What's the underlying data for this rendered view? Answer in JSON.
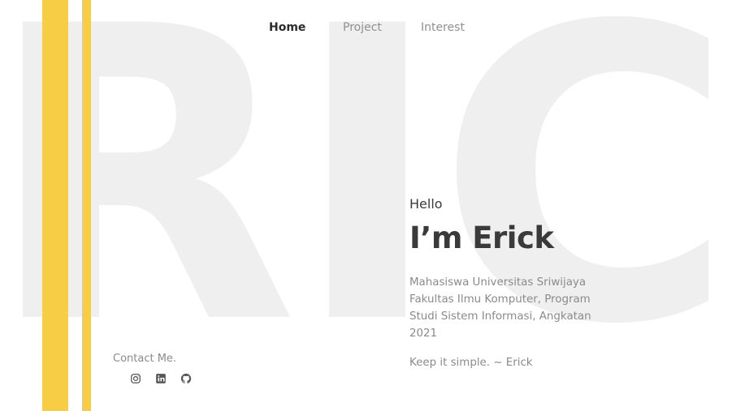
{
  "background": {
    "word": "RICK"
  },
  "nav": {
    "items": [
      {
        "label": "Home",
        "active": true
      },
      {
        "label": "Project",
        "active": false
      },
      {
        "label": "Interest",
        "active": false
      }
    ]
  },
  "hero": {
    "greeting": "Hello",
    "name": "I’m Erick",
    "bio": "Mahasiswa Universitas Sriwijaya Fakultas Ilmu Komputer, Program Studi Sistem Informasi, Angkatan 2021",
    "tagline": "Keep it simple. ~ Erick"
  },
  "contact": {
    "label": "Contact Me.",
    "socials": [
      {
        "icon": "instagram-icon"
      },
      {
        "icon": "linkedin-icon"
      },
      {
        "icon": "github-icon"
      }
    ]
  },
  "colors": {
    "accent": "#f7cd45",
    "background_text": "#efefef",
    "heading": "#3a3a3a",
    "muted": "#8a8a8a"
  }
}
